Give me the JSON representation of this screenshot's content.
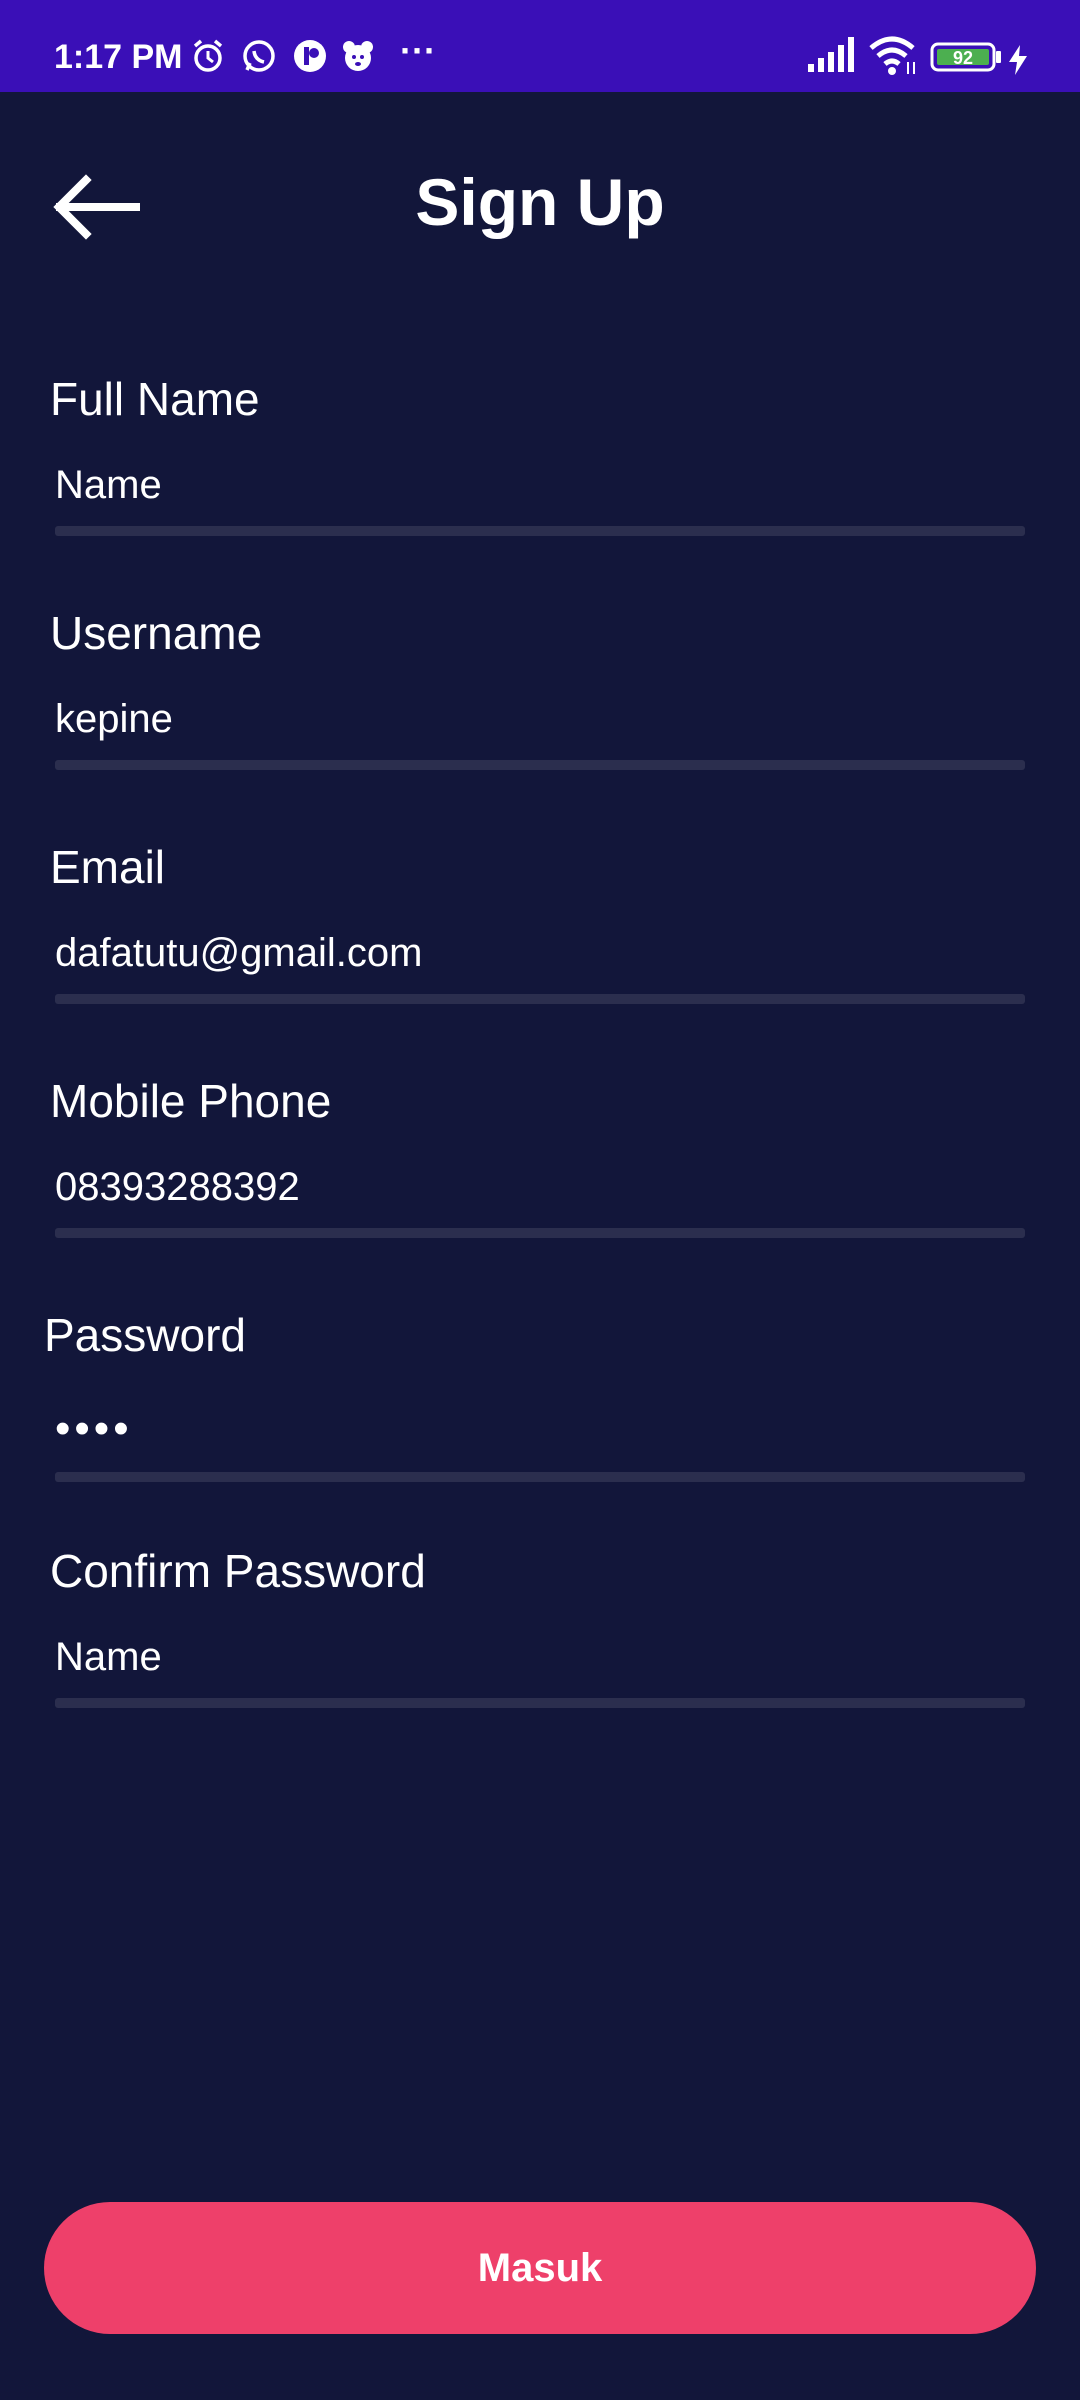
{
  "status_bar": {
    "time": "1:17 PM",
    "more": "···",
    "battery": "92",
    "icons": [
      "alarm-icon",
      "whatsapp-icon",
      "app-icon",
      "cartoon-app-icon",
      "signal-icon",
      "wifi-icon",
      "battery-icon",
      "charging-icon"
    ]
  },
  "header": {
    "title": "Sign Up",
    "back_icon": "arrow-left-icon"
  },
  "form": {
    "full_name": {
      "label": "Full Name",
      "value": "",
      "placeholder": "Name"
    },
    "username": {
      "label": "Username",
      "value": "kepine",
      "placeholder": ""
    },
    "email": {
      "label": "Email",
      "value": "dafatutu@gmail.com",
      "placeholder": ""
    },
    "mobile_phone": {
      "label": "Mobile Phone",
      "value": "08393288392",
      "placeholder": ""
    },
    "password": {
      "label": "Password",
      "value": "••••",
      "placeholder": ""
    },
    "confirm_password": {
      "label": "Confirm Password",
      "value": "",
      "placeholder": "Name"
    }
  },
  "submit": {
    "label": "Masuk"
  },
  "colors": {
    "background": "#12163a",
    "status_bar": "#3a0fb7",
    "accent": "#ee406a",
    "underline": "#2b2e4e"
  }
}
